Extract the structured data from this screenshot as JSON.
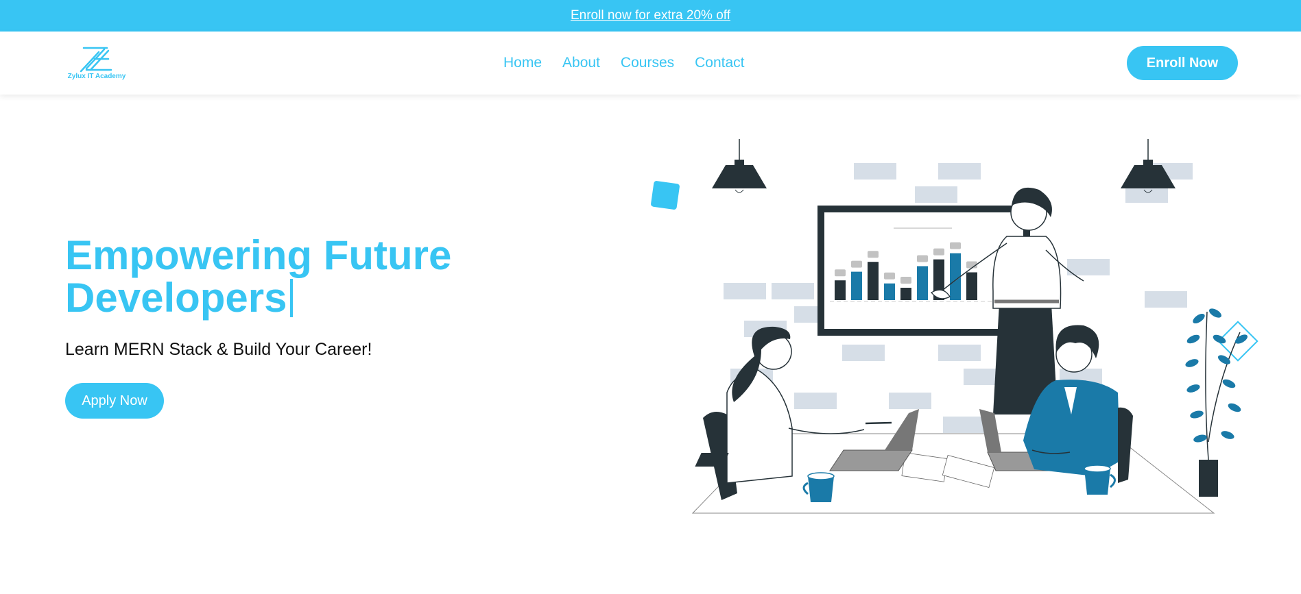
{
  "promo": {
    "text": "Enroll now for extra 20% off"
  },
  "brand": {
    "name": "Zylux IT Academy"
  },
  "nav": {
    "items": [
      {
        "label": "Home"
      },
      {
        "label": "About"
      },
      {
        "label": "Courses"
      },
      {
        "label": "Contact"
      }
    ],
    "cta": "Enroll Now"
  },
  "hero": {
    "title_line1": "Empowering Future",
    "title_line2": "Developers",
    "subtitle": "Learn MERN Stack & Build Your Career!",
    "cta": "Apply Now"
  },
  "illustration": {
    "bars": [
      {
        "value": 0.32,
        "color": "dark"
      },
      {
        "value": 0.46,
        "color": "blue"
      },
      {
        "value": 0.62,
        "color": "dark"
      },
      {
        "value": 0.27,
        "color": "blue"
      },
      {
        "value": 0.2,
        "color": "dark"
      },
      {
        "value": 0.55,
        "color": "blue"
      },
      {
        "value": 0.66,
        "color": "dark"
      },
      {
        "value": 0.76,
        "color": "blue"
      },
      {
        "value": 0.45,
        "color": "dark"
      }
    ]
  },
  "colors": {
    "accent": "#38c5f3",
    "dark": "#263238",
    "blue": "#1a7aa8",
    "brick": "#d6dee7"
  }
}
